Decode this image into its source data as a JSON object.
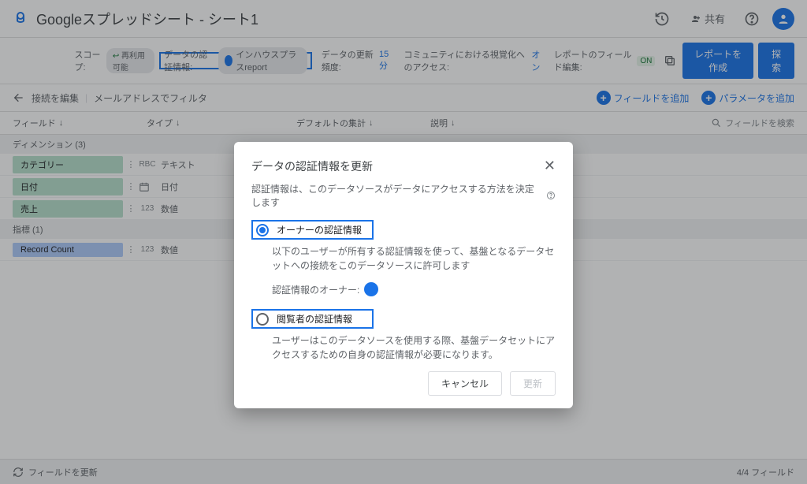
{
  "header": {
    "title": "Googleスプレッドシート - シート1",
    "share_label": "共有"
  },
  "settings": {
    "scope_label": "スコープ:",
    "scope_value": "再利用可能",
    "cred_label": "データの認証情報:",
    "cred_user": "インハウスプラスreport",
    "refresh_label": "データの更新頻度:",
    "refresh_value": "15 分",
    "community_label": "コミュニティにおける視覚化へのアクセス:",
    "community_value": "オン",
    "field_edit_label": "レポートのフィールド編集:",
    "field_edit_value": "ON",
    "create_report_btn": "レポートを作成",
    "explore_btn": "探索"
  },
  "toolbar": {
    "edit_connection": "接続を編集",
    "filter": "メールアドレスでフィルタ",
    "add_field": "フィールドを追加",
    "add_param": "パラメータを追加"
  },
  "columns": {
    "field": "フィールド",
    "type": "タイプ",
    "agg": "デフォルトの集計",
    "desc": "説明",
    "search": "フィールドを検索"
  },
  "dim_section": "ディメンション (3)",
  "met_section": "指標 (1)",
  "rows": [
    {
      "name": "カテゴリー",
      "type_icon": "RBC",
      "type": "テキスト"
    },
    {
      "name": "日付",
      "type_icon": "cal",
      "type": "日付"
    },
    {
      "name": "売上",
      "type_icon": "123",
      "type": "数値"
    }
  ],
  "metrics": [
    {
      "name": "Record Count",
      "type_icon": "123",
      "type": "数値"
    }
  ],
  "footer": {
    "refresh": "フィールドを更新",
    "count": "4/4 フィールド"
  },
  "dialog": {
    "title": "データの認証情報を更新",
    "sub": "認証情報は、このデータソースがデータにアクセスする方法を決定します",
    "opt1_label": "オーナーの認証情報",
    "opt1_desc": "以下のユーザーが所有する認証情報を使って、基盤となるデータセットへの接続をこのデータソースに許可します",
    "owner_label": "認証情報のオーナー:",
    "opt2_label": "閲覧者の認証情報",
    "opt2_desc": "ユーザーはこのデータソースを使用する際、基盤データセットにアクセスするための自身の認証情報が必要になります。",
    "cancel": "キャンセル",
    "update": "更新"
  }
}
